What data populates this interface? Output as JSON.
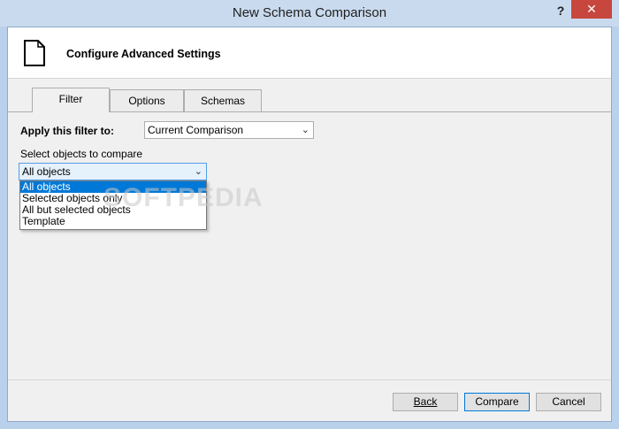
{
  "window": {
    "title": "New Schema Comparison",
    "help_glyph": "?",
    "close_glyph": "✕"
  },
  "header": {
    "title": "Configure Advanced Settings",
    "icon": "document-icon"
  },
  "tabs": [
    {
      "label": "Filter",
      "active": true
    },
    {
      "label": "Options",
      "active": false
    },
    {
      "label": "Schemas",
      "active": false
    }
  ],
  "filter": {
    "apply_label": "Apply this filter to:",
    "apply_value": "Current Comparison",
    "select_label": "Select objects to compare",
    "select_value": "All objects",
    "options": [
      "All objects",
      "Selected objects only",
      "All but selected objects",
      "Template"
    ],
    "selected_index": 0
  },
  "watermark": "SOFTPEDIA",
  "buttons": {
    "back_label": "Back",
    "compare_label": "Compare",
    "cancel_label": "Cancel"
  }
}
